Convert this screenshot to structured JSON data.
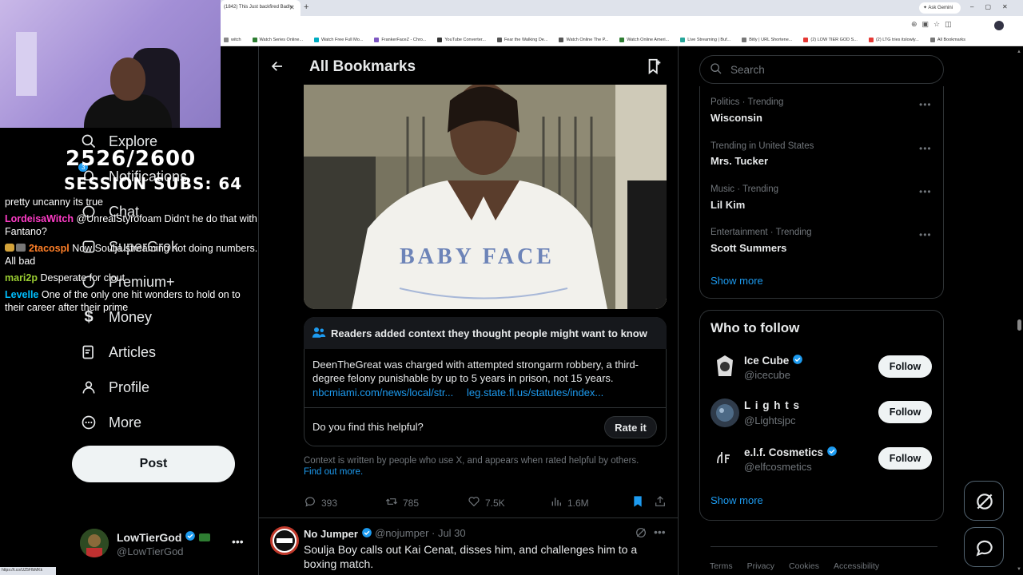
{
  "browser": {
    "tab_title": "(1842) This Just backfired Badly",
    "ask_gemini": "Ask Gemini",
    "bookmarks": [
      {
        "label": "witch",
        "color": "#888888"
      },
      {
        "label": "Watch Series Online...",
        "color": "#2e7d32"
      },
      {
        "label": "Watch Free Full Mo...",
        "color": "#00acc1"
      },
      {
        "label": "FrankerFaceZ - Chro...",
        "color": "#7e57c2"
      },
      {
        "label": "YouTube Converter...",
        "color": "#333333"
      },
      {
        "label": "Fear the Walking De...",
        "color": "#555555"
      },
      {
        "label": "Watch Online The P...",
        "color": "#555555"
      },
      {
        "label": "Watch Online Ameri...",
        "color": "#2e7d32"
      },
      {
        "label": "Live Streaming | Buf...",
        "color": "#26a69a"
      },
      {
        "label": "Bitly | URL Shortene...",
        "color": "#777777"
      },
      {
        "label": "(2) LOW TIER GOD S...",
        "color": "#e53935"
      },
      {
        "label": "(2) LTG tries itslowly...",
        "color": "#e53935"
      },
      {
        "label": "All Bookmarks",
        "color": "#777777"
      }
    ],
    "status_url": "https://t.co/UZ5FfbMKk"
  },
  "overlay": {
    "sub_count": "2526/2600",
    "session_subs": "SESSION SUBS: 64",
    "chat": [
      {
        "user": "",
        "user_color": "#ffffff",
        "message": "pretty uncanny its true"
      },
      {
        "user": "LordeisaWitch",
        "user_color": "#ff3cc7",
        "message": "@UnrealStyrofoam Didn't he do that with Fantano?"
      },
      {
        "user": "2tacospl",
        "user_color": "#ff7f27",
        "message": "Now Soulja streaming not doing numbers. All bad"
      },
      {
        "user": "mari2p",
        "user_color": "#9acd32",
        "message": "Desperate for clout"
      },
      {
        "user": "Levelle",
        "user_color": "#00bfff",
        "message": "One of the only one hit wonders to hold on to their career after their prime"
      }
    ]
  },
  "nav": {
    "notification_badge": "3",
    "items": [
      {
        "label": "Explore"
      },
      {
        "label": "Notifications"
      },
      {
        "label": "Chat"
      },
      {
        "label": "SuperGrok"
      },
      {
        "label": "Premium+"
      },
      {
        "label": "Money"
      },
      {
        "label": "Articles"
      },
      {
        "label": "Profile"
      },
      {
        "label": "More"
      }
    ],
    "post_label": "Post"
  },
  "account": {
    "name": "LowTierGod",
    "handle": "@LowTierGod"
  },
  "main": {
    "title": "All Bookmarks",
    "photo_jersey_text": "BABY FACE",
    "community_note": {
      "title": "Readers added context they thought people might want to know",
      "text": "DeenTheGreat was charged with attempted strongarm robbery, a third-degree felony punishable by up to 5 years in prison, not 15 years.",
      "link_1": "nbcmiami.com/news/local/str...",
      "link_2": "leg.state.fl.us/statutes/index...",
      "helpful_question": "Do you find this helpful?",
      "rate_label": "Rate it",
      "footer": "Context is written by people who use X, and appears when rated helpful by others.",
      "find_out_more": "Find out more."
    },
    "actions": {
      "replies": "393",
      "reposts": "785",
      "likes": "7.5K",
      "views": "1.6M"
    },
    "next_post": {
      "name": "No Jumper",
      "handle": "@nojumper · Jul 30",
      "text": "Soulja Boy calls out Kai Cenat, disses him, and challenges him to a boxing match."
    }
  },
  "right": {
    "search_placeholder": "Search",
    "trends": [
      {
        "meta": "Politics · Trending",
        "name": "Wisconsin"
      },
      {
        "meta": "Trending in United States",
        "name": "Mrs. Tucker"
      },
      {
        "meta": "Music · Trending",
        "name": "Lil Kim"
      },
      {
        "meta": "Entertainment · Trending",
        "name": "Scott Summers"
      }
    ],
    "trends_show_more": "Show more",
    "who_to_follow": {
      "title": "Who to follow",
      "accounts": [
        {
          "name": "Ice Cube",
          "handle": "@icecube",
          "verified": true,
          "follow": "Follow"
        },
        {
          "name": "L i g h t s",
          "handle": "@Lightsjpc",
          "verified": false,
          "follow": "Follow"
        },
        {
          "name": "e.l.f. Cosmetics",
          "handle": "@elfcosmetics",
          "verified": true,
          "follow": "Follow"
        }
      ],
      "show_more": "Show more"
    },
    "footer_links": [
      "Terms",
      "Privacy",
      "Cookies",
      "Accessibility"
    ]
  },
  "colors": {
    "accent": "#1d9bf0",
    "verified": "#1d9bf0",
    "muted": "#71767b",
    "border": "#2f3336"
  }
}
